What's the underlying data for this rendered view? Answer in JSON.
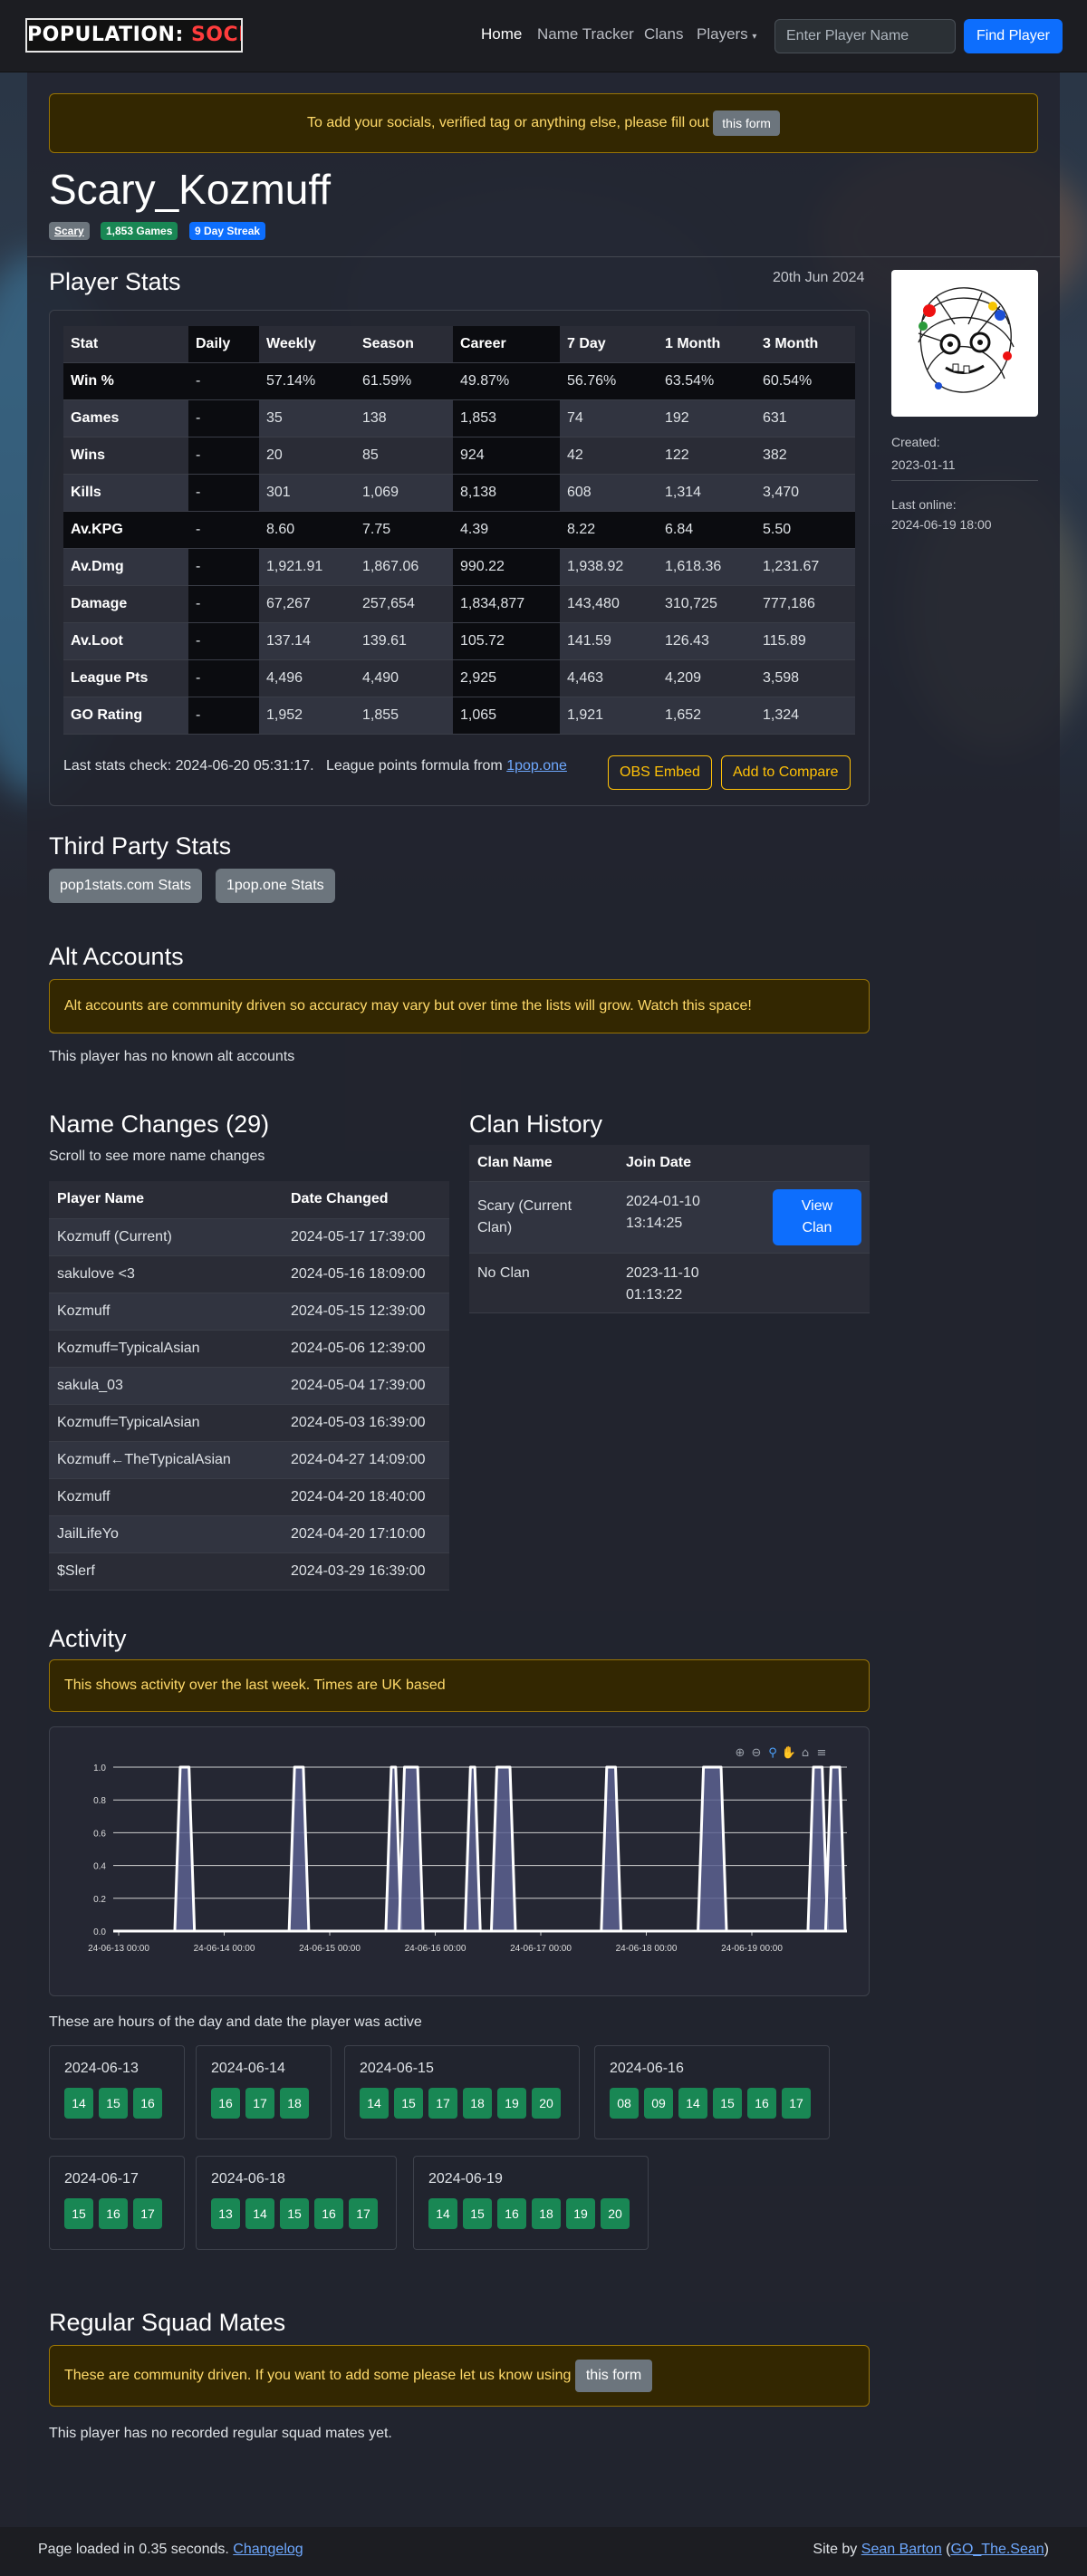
{
  "nav": {
    "logo_left": "POPULATION:",
    "logo_right": "SOCIALS",
    "links": [
      "Home",
      "Name Tracker",
      "Clans",
      "Players"
    ],
    "search_placeholder": "Enter Player Name",
    "find_label": "Find Player"
  },
  "top_alert": {
    "text": "To add your socials, verified tag or anything else, please fill out",
    "button": "this form"
  },
  "player": {
    "name": "Scary_Kozmuff",
    "badges": [
      {
        "label": "Scary",
        "color": "#6c757d"
      },
      {
        "label": "1,853 Games",
        "color": "#198754"
      },
      {
        "label": "9 Day Streak",
        "color": "#0d6efd"
      }
    ],
    "created_label": "Created:",
    "created": "2023-01-11",
    "last_online_label": "Last online:",
    "last_online": "2024-06-19 18:00"
  },
  "stats": {
    "heading": "Player Stats",
    "date": "20th Jun 2024",
    "columns": [
      "Stat",
      "Daily",
      "Weekly",
      "Season",
      "Career",
      "7 Day",
      "1 Month",
      "3 Month"
    ],
    "rows": [
      [
        "Win %",
        "-",
        "57.14%",
        "61.59%",
        "49.87%",
        "56.76%",
        "63.54%",
        "60.54%"
      ],
      [
        "Games",
        "-",
        "35",
        "138",
        "1,853",
        "74",
        "192",
        "631"
      ],
      [
        "Wins",
        "-",
        "20",
        "85",
        "924",
        "42",
        "122",
        "382"
      ],
      [
        "Kills",
        "-",
        "301",
        "1,069",
        "8,138",
        "608",
        "1,314",
        "3,470"
      ],
      [
        "Av.KPG",
        "-",
        "8.60",
        "7.75",
        "4.39",
        "8.22",
        "6.84",
        "5.50"
      ],
      [
        "Av.Dmg",
        "-",
        "1,921.91",
        "1,867.06",
        "990.22",
        "1,938.92",
        "1,618.36",
        "1,231.67"
      ],
      [
        "Damage",
        "-",
        "67,267",
        "257,654",
        "1,834,877",
        "143,480",
        "310,725",
        "777,186"
      ],
      [
        "Av.Loot",
        "-",
        "137.14",
        "139.61",
        "105.72",
        "141.59",
        "126.43",
        "115.89"
      ],
      [
        "League Pts",
        "-",
        "4,496",
        "4,490",
        "2,925",
        "4,463",
        "4,209",
        "3,598"
      ],
      [
        "GO Rating",
        "-",
        "1,952",
        "1,855",
        "1,065",
        "1,921",
        "1,652",
        "1,324"
      ]
    ],
    "last_check": "Last stats check: 2024-06-20 05:31:17.",
    "formula_text": "League points formula from",
    "formula_link": "1pop.one",
    "obs_label": "OBS Embed",
    "compare_label": "Add to Compare"
  },
  "third_party": {
    "heading": "Third Party Stats",
    "buttons": [
      "pop1stats.com Stats",
      "1pop.one Stats"
    ]
  },
  "alts": {
    "heading": "Alt Accounts",
    "alert": "Alt accounts are community driven so accuracy may vary but over time the lists will grow. Watch this space!",
    "empty": "This player has no known alt accounts"
  },
  "names": {
    "heading": "Name Changes (29)",
    "hint": "Scroll to see more name changes",
    "columns": [
      "Player Name",
      "Date Changed"
    ],
    "rows": [
      [
        "Kozmuff (Current)",
        "2024-05-17 17:39:00"
      ],
      [
        "sakulove <3",
        "2024-05-16 18:09:00"
      ],
      [
        "Kozmuff",
        "2024-05-15 12:39:00"
      ],
      [
        "Kozmuff=TypicalAsian",
        "2024-05-06 12:39:00"
      ],
      [
        "sakula_03",
        "2024-05-04 17:39:00"
      ],
      [
        "Kozmuff=TypicalAsian",
        "2024-05-03 16:39:00"
      ],
      [
        "Kozmuff←TheTypicalAsian",
        "2024-04-27 14:09:00"
      ],
      [
        "Kozmuff",
        "2024-04-20 18:40:00"
      ],
      [
        "JailLifeYo",
        "2024-04-20 17:10:00"
      ],
      [
        "$Slerf",
        "2024-03-29 16:39:00"
      ]
    ]
  },
  "clans": {
    "heading": "Clan History",
    "columns": [
      "Clan Name",
      "Join Date"
    ],
    "rows": [
      {
        "name_l1": "Scary (Current",
        "name_l2": "Clan)",
        "date_l1": "2024-01-10",
        "date_l2": "13:14:25",
        "button_l1": "View",
        "button_l2": "Clan"
      },
      {
        "name_l1": "No Clan",
        "name_l2": "",
        "date_l1": "2023-11-10",
        "date_l2": "01:13:22"
      }
    ]
  },
  "activity": {
    "heading": "Activity",
    "alert": "This shows activity over the last week. Times are UK based",
    "chart_hint": "These are hours of the day and date the player was active",
    "days": [
      {
        "date": "2024-06-13",
        "hours": [
          "14",
          "15",
          "16"
        ]
      },
      {
        "date": "2024-06-14",
        "hours": [
          "16",
          "17",
          "18"
        ]
      },
      {
        "date": "2024-06-15",
        "hours": [
          "14",
          "15",
          "17",
          "18",
          "19",
          "20"
        ]
      },
      {
        "date": "2024-06-16",
        "hours": [
          "08",
          "09",
          "14",
          "15",
          "16",
          "17"
        ]
      },
      {
        "date": "2024-06-17",
        "hours": [
          "15",
          "16",
          "17"
        ]
      },
      {
        "date": "2024-06-18",
        "hours": [
          "13",
          "14",
          "15",
          "16",
          "17"
        ]
      },
      {
        "date": "2024-06-19",
        "hours": [
          "14",
          "15",
          "16",
          "18",
          "19",
          "20"
        ]
      }
    ]
  },
  "chart_data": {
    "type": "area",
    "title": "",
    "xlabel": "",
    "ylabel": "",
    "ylim": [
      0,
      1
    ],
    "y_ticks": [
      "0.0",
      "0.2",
      "0.4",
      "0.6",
      "0.8",
      "1.0"
    ],
    "x_ticks": [
      "24-06-13 00:00",
      "24-06-14 00:00",
      "24-06-15 00:00",
      "24-06-16 00:00",
      "24-06-17 00:00",
      "24-06-18 00:00",
      "24-06-19 00:00"
    ],
    "x_start": "2024-06-13 00:00",
    "series": [
      {
        "values": [
          {
            "from": "2024-06-13 14:00",
            "to": "2024-06-13 16:00",
            "y": 1
          },
          {
            "from": "2024-06-14 16:00",
            "to": "2024-06-14 18:00",
            "y": 1
          },
          {
            "from": "2024-06-15 14:00",
            "to": "2024-06-15 15:00",
            "y": 1
          },
          {
            "from": "2024-06-15 17:00",
            "to": "2024-06-15 20:00",
            "y": 1
          },
          {
            "from": "2024-06-16 08:00",
            "to": "2024-06-16 09:00",
            "y": 1
          },
          {
            "from": "2024-06-16 14:00",
            "to": "2024-06-16 17:00",
            "y": 1
          },
          {
            "from": "2024-06-17 15:00",
            "to": "2024-06-17 17:00",
            "y": 1
          },
          {
            "from": "2024-06-18 13:00",
            "to": "2024-06-18 17:00",
            "y": 1
          },
          {
            "from": "2024-06-19 14:00",
            "to": "2024-06-19 16:00",
            "y": 1
          },
          {
            "from": "2024-06-19 18:00",
            "to": "2024-06-19 20:00",
            "y": 1
          }
        ]
      }
    ],
    "toolbar": [
      "zoom-in-icon",
      "zoom-out-icon",
      "magnify-icon",
      "pan-hand-icon",
      "home-icon",
      "menu-icon"
    ],
    "fill_color": "#5c6290",
    "line_color": "#ffffff"
  },
  "squad": {
    "heading": "Regular Squad Mates",
    "alert": "These are community driven. If you want to add some please let us know using",
    "button": "this form",
    "empty": "This player has no recorded regular squad mates yet."
  },
  "footer": {
    "loaded": "Page loaded in 0.35 seconds.",
    "changelog": "Changelog",
    "site_by": "Site by",
    "author": "Sean Barton",
    "handle": "GO_The.Sean"
  }
}
